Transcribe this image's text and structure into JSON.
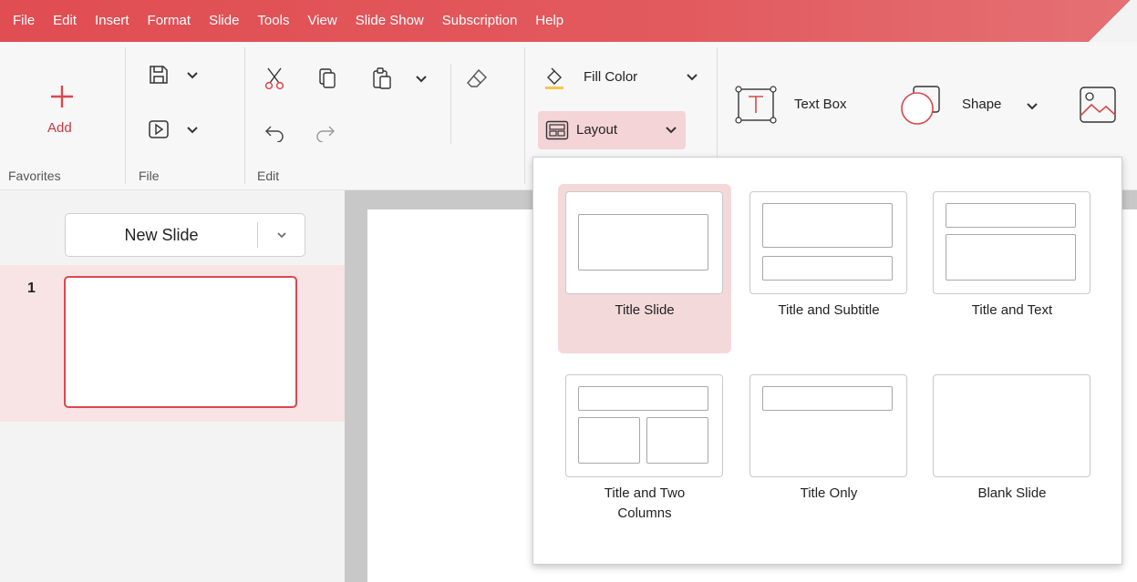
{
  "menu": [
    "File",
    "Edit",
    "Insert",
    "Format",
    "Slide",
    "Tools",
    "View",
    "Slide Show",
    "Subscription",
    "Help"
  ],
  "ribbon": {
    "favorites": {
      "add_label": "Add",
      "group_label": "Favorites"
    },
    "file": {
      "group_label": "File"
    },
    "edit": {
      "group_label": "Edit"
    },
    "fill_color_label": "Fill Color",
    "layout_label": "Layout",
    "text_box_label": "Text Box",
    "shape_label": "Shape"
  },
  "slides_panel": {
    "new_slide_label": "New Slide",
    "slides": [
      {
        "number": "1"
      }
    ]
  },
  "layout_menu": {
    "selected": "Title Slide",
    "items": [
      {
        "label": "Title Slide"
      },
      {
        "label": "Title and Subtitle"
      },
      {
        "label": "Title and Text"
      },
      {
        "label": "Title and Two Columns"
      },
      {
        "label": "Title Only"
      },
      {
        "label": "Blank Slide"
      }
    ]
  },
  "colors": {
    "accent": "#e04d52",
    "selection": "#f4d9db"
  }
}
